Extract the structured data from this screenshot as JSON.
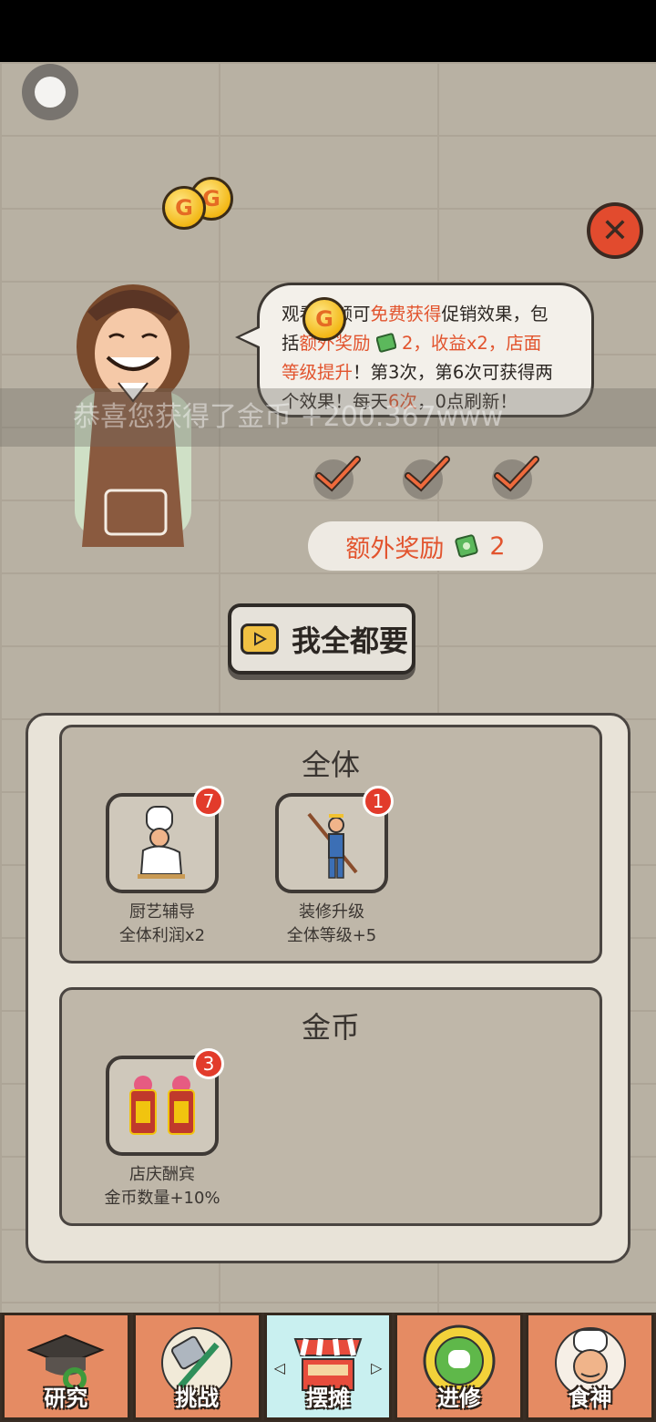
{
  "bubble": {
    "line1_a": "观看视频可",
    "line1_b": "免费获得",
    "line1_c": "促销效果，包",
    "line2_a": "括",
    "line2_b": "额外奖励",
    "line2_c": "2，",
    "line2_d": "收益x2，店面",
    "line3_a": "等级提升",
    "line3_b": "！第3次，第6次可获得两",
    "line4_a": "个效果！每天",
    "line4_b": "6次",
    "line4_c": "，0点刷新！"
  },
  "toast": "恭喜您获得了金币 +200.367www",
  "extra": {
    "label": "额外奖励",
    "count": "2"
  },
  "want_all": "我全都要",
  "sections": [
    {
      "title": "全体",
      "items": [
        {
          "name": "厨艺辅导",
          "effect": "全体利润x2",
          "badge": "7"
        },
        {
          "name": "装修升级",
          "effect": "全体等级+5",
          "badge": "1"
        }
      ]
    },
    {
      "title": "金币",
      "items": [
        {
          "name": "店庆酬宾",
          "effect": "金币数量+10%",
          "badge": "3"
        }
      ]
    }
  ],
  "nav": [
    "研究",
    "挑战",
    "摆摊",
    "进修",
    "食神"
  ],
  "coin_letter": "G",
  "colors": {
    "accent_red": "#e2542e",
    "tab_active": "#c9f0f0",
    "tab_default": "#e58b63"
  }
}
